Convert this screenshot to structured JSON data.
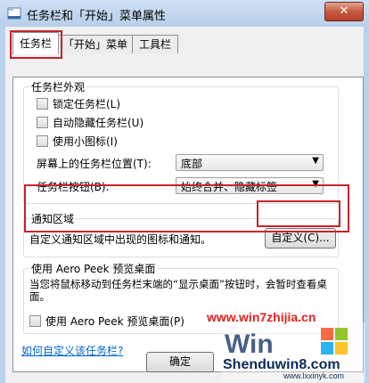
{
  "window": {
    "title": "任务栏和「开始」菜单属性",
    "close": "✕"
  },
  "tabs": [
    {
      "label": "任务栏",
      "active": true
    },
    {
      "label": "「开始」菜单",
      "active": false
    },
    {
      "label": "工具栏",
      "active": false
    }
  ],
  "appearance": {
    "legend": "任务栏外观",
    "checkboxes": [
      {
        "label": "锁定任务栏(L)",
        "checked": false
      },
      {
        "label": "自动隐藏任务栏(U)",
        "checked": false
      },
      {
        "label": "使用小图标(I)",
        "checked": false
      }
    ],
    "position_label": "屏幕上的任务栏位置(T):",
    "position_value": "底部",
    "buttons_label": "任务栏按钮(B):",
    "buttons_value": "始终合并、隐藏标签"
  },
  "notification": {
    "legend": "通知区域",
    "description": "自定义通知区域中出现的图标和通知。",
    "customize_button": "自定义(C)..."
  },
  "aero_peek": {
    "legend": "使用 Aero Peek 预览桌面",
    "description": "当您将鼠标移动到任务栏末端的“显示桌面”按钮时，会暂时查看桌面。",
    "checkbox_label": "使用 Aero Peek 预览桌面(P)",
    "checked": false
  },
  "help_link": "如何自定义该任务栏?",
  "footer": {
    "ok": "确定"
  },
  "watermark": {
    "site": "www.win7zhijia.cn",
    "brand": "Shenduwin8.com",
    "domain": "www.lxxinyk.com"
  },
  "colors": {
    "highlight": "#c8222a",
    "link": "#0066cc"
  }
}
